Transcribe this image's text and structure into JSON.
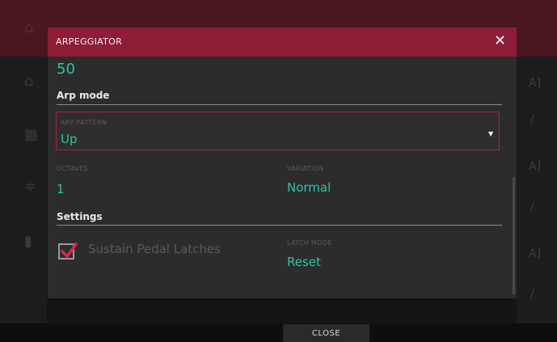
{
  "dialog": {
    "title": "ARPEGGIATOR",
    "close_glyph": "✕",
    "top_value": "50"
  },
  "arp_mode": {
    "section_label": "Arp mode",
    "pattern_label": "ARP PATTERN",
    "pattern_value": "Up",
    "octaves_label": "OCTAVES",
    "octaves_value": "1",
    "variation_label": "VARIATION",
    "variation_value": "Normal"
  },
  "settings": {
    "section_label": "Settings",
    "sustain_label": "Sustain Pedal Latches",
    "sustain_checked": true,
    "latch_mode_label": "LATCH MODE",
    "latch_mode_value": "Reset"
  },
  "footer": {
    "close_label": "CLOSE"
  },
  "colors": {
    "accent": "#8e1d37",
    "value": "#2ec4a3",
    "check": "#e0244d"
  },
  "icons": {
    "close": "close-icon",
    "dropdown": "chevron-down-icon",
    "home": "home-icon",
    "edit": "pencil-icon"
  }
}
